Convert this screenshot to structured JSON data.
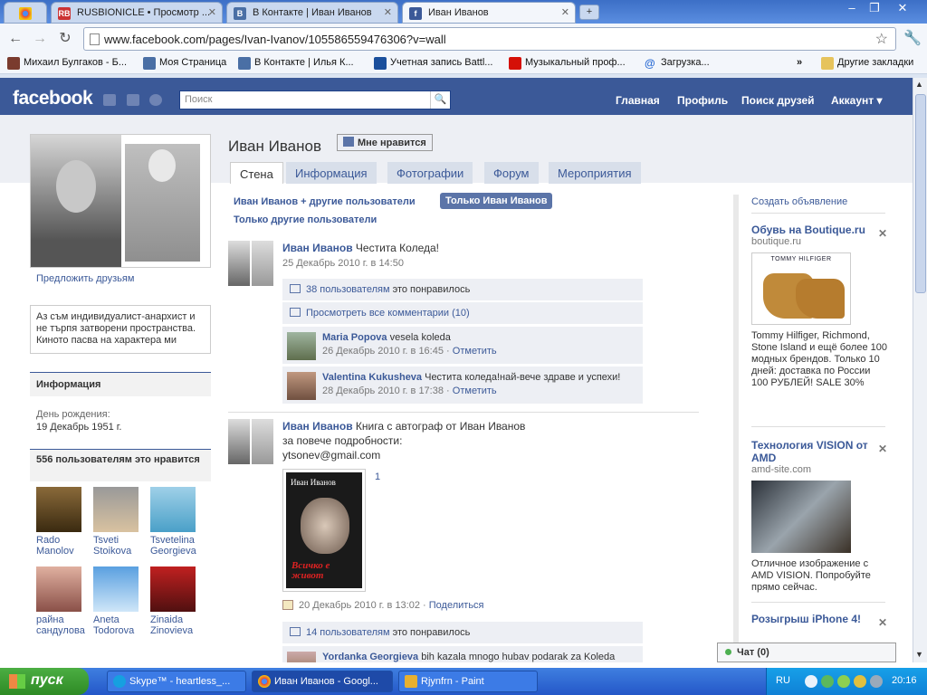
{
  "browser": {
    "tabs": [
      {
        "label": "",
        "icon": "chrome-icon"
      },
      {
        "label": "RUSBIONICLE • Просмотр ...",
        "icon": "rb-icon"
      },
      {
        "label": "В Контакте | Иван Иванов",
        "icon": "vk-icon"
      },
      {
        "label": "Иван Иванов",
        "icon": "facebook-icon"
      }
    ],
    "url": "www.facebook.com/pages/Ivan-Ivanov/105586559476306?v=wall",
    "bookmarks": [
      "Михаил Булгаков - Б...",
      "Моя Страница",
      "В Контакте | Илья К...",
      "Учетная запись Battl...",
      "Музыкальный проф...",
      "Загрузка...",
      "Другие закладки"
    ]
  },
  "fb": {
    "logo": "facebook",
    "search_placeholder": "Поиск",
    "nav": [
      "Главная",
      "Профиль",
      "Поиск друзей",
      "Аккаунт ▾"
    ]
  },
  "profile": {
    "name": "Иван Иванов",
    "like_button": "Мне нравится",
    "suggest_friends": "Предложить друзьям",
    "bio": "Аз съм индивидуалист-анархист и не търпя затворени пространства. Киното пасва на характера ми",
    "info_title": "Информация",
    "birthday_label": "День рождения:",
    "birthday": "19 Декабрь 1951 г.",
    "likes_title": "556 пользователям это нравится",
    "fans": [
      {
        "name": "Rado Manolov"
      },
      {
        "name": "Tsveti Stoikova"
      },
      {
        "name": "Tsvetelina Georgieva"
      },
      {
        "name": "райна сандулова"
      },
      {
        "name": "Aneta Todorova"
      },
      {
        "name": "Zinaida Zinovieva"
      }
    ]
  },
  "tabs": [
    "Стена",
    "Информация",
    "Фотографии",
    "Форум",
    "Мероприятия"
  ],
  "filters": {
    "all": "Иван Иванов + другие пользователи",
    "only": "Только Иван Иванов",
    "others": "Только другие пользователи"
  },
  "posts": [
    {
      "author": "Иван Иванов",
      "text": "Честита Коледа!",
      "time": "25 Декабрь 2010 г. в 14:50",
      "likes": "38 пользователям",
      "likes_suffix": "это понравилось",
      "view_comments": "Просмотреть все комментарии (10)",
      "comments": [
        {
          "author": "Maria Popova",
          "text": "vesela koleda",
          "time": "26 Декабрь 2010 г. в 16:45",
          "action": "Отметить"
        },
        {
          "author": "Valentina Kukusheva",
          "text": "Честита коледа!най-вече здраве и успехи!",
          "time": "28 Декабрь 2010 г. в 17:38",
          "action": "Отметить"
        }
      ]
    },
    {
      "author": "Иван Иванов",
      "text_line1": "Книга с автограф от Иван Иванов",
      "text_line2": "за повече подробности:",
      "text_line3": "ytsonev@gmail.com",
      "photo_count": "1",
      "book_author": "Иван Иванов",
      "book_title": "Всичко е живот",
      "time": "20 Декабрь 2010 г. в 13:02",
      "share": "Поделиться",
      "likes": "14 пользователям",
      "likes_suffix": "это понравилось",
      "comment_author": "Yordanka Georgieva",
      "comment_text": "bih kazala mnogo hubav podarak za Koleda"
    }
  ],
  "ads": {
    "create": "Создать объявление",
    "items": [
      {
        "title": "Обувь на Boutique.ru",
        "domain": "boutique.ru",
        "brand": "TOMMY HILFIGER",
        "desc": "Tommy Hilfiger, Richmond, Stone Island и ещё более 100 модных брендов. Только 10 дней: доставка по России 100 РУБЛЕЙ! SALE 30%"
      },
      {
        "title": "Технология VISION от AMD",
        "domain": "amd-site.com",
        "desc": "Отличное изображение с AMD VISION. Попробуйте прямо сейчас."
      },
      {
        "title": "Розыгрыш iPhone 4!",
        "domain": "",
        "desc": ""
      }
    ]
  },
  "chat": "Чат (0)",
  "taskbar": {
    "start": "пуск",
    "tasks": [
      "Skype™ - heartless_...",
      "Иван Иванов - Googl...",
      "Rjynfrn - Paint"
    ],
    "lang": "RU",
    "clock": "20:16"
  }
}
